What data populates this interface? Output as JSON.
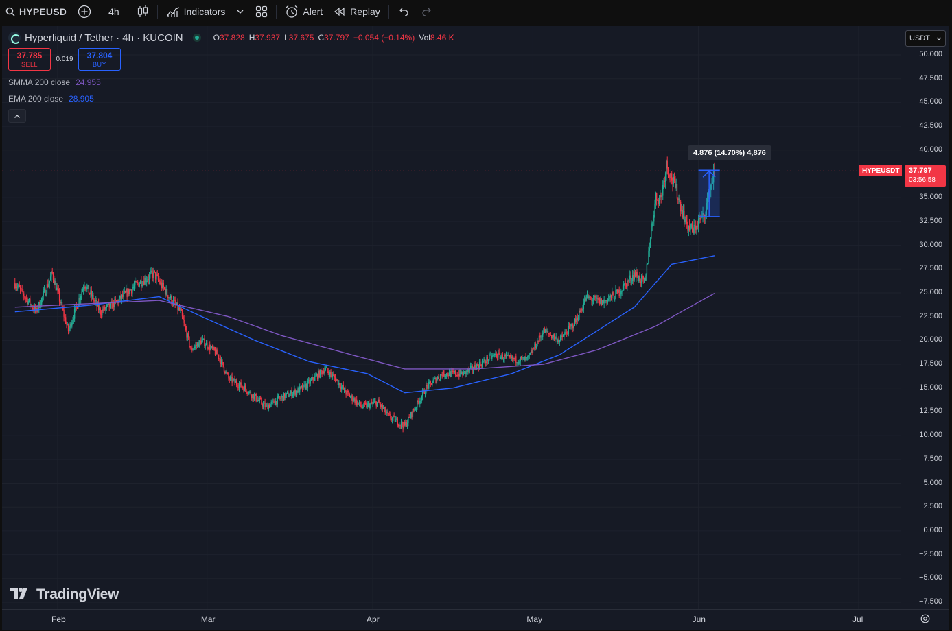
{
  "toolbar": {
    "symbol": "HYPEUSD",
    "interval": "4h",
    "indicators_label": "Indicators",
    "alert_label": "Alert",
    "replay_label": "Replay"
  },
  "legend": {
    "title": "Hyperliquid / Tether · 4h · KUCOIN",
    "ohlc": [
      {
        "k": "O",
        "v": "37.828"
      },
      {
        "k": "H",
        "v": "37.937"
      },
      {
        "k": "L",
        "v": "37.675"
      },
      {
        "k": "C",
        "v": "37.797"
      },
      {
        "k": "",
        "v": "−0.054 (−0.14%)"
      },
      {
        "k": "Vol",
        "v": "8.46 K"
      }
    ],
    "sell_price": "37.785",
    "sell_label": "SELL",
    "spread": "0.019",
    "buy_price": "37.804",
    "buy_label": "BUY",
    "indicators": [
      {
        "name": "SMMA",
        "params": "200 close",
        "value": "24.955",
        "color": "#7e57c2"
      },
      {
        "name": "EMA",
        "params": "200 close",
        "value": "28.905",
        "color": "#2962ff"
      }
    ]
  },
  "currency": "USDT",
  "price_scale": {
    "ticks": [
      "50.000",
      "47.500",
      "45.000",
      "42.500",
      "40.000",
      "35.000",
      "32.500",
      "30.000",
      "27.500",
      "25.000",
      "22.500",
      "20.000",
      "17.500",
      "15.000",
      "12.500",
      "10.000",
      "7.500",
      "5.000",
      "2.500",
      "0.000",
      "−2.500",
      "−5.000",
      "−7.500"
    ],
    "last_price": "37.797",
    "countdown": "03:56:58",
    "symbol_tag": "HYPEUSDT"
  },
  "time_scale": {
    "labels": [
      "Feb",
      "Mar",
      "Apr",
      "May",
      "Jun",
      "Jul"
    ]
  },
  "measure": {
    "label": "4.876 (14.70%) 4,876"
  },
  "watermark": "TradingView",
  "colors": {
    "up": "#22ab94",
    "down": "#f23645",
    "ema": "#2962ff",
    "smma": "#7e57c2",
    "background": "#161a25"
  },
  "chart_data": {
    "type": "candlestick",
    "ylim": [
      -7.5,
      50
    ],
    "x_months": [
      "Feb",
      "Mar",
      "Apr",
      "May",
      "Jun",
      "Jul"
    ],
    "price_path": [
      {
        "date": "2025-01-24",
        "price": 26
      },
      {
        "date": "2025-01-28",
        "price": 23
      },
      {
        "date": "2025-01-31",
        "price": 27
      },
      {
        "date": "2025-02-03",
        "price": 21
      },
      {
        "date": "2025-02-06",
        "price": 26
      },
      {
        "date": "2025-02-09",
        "price": 23
      },
      {
        "date": "2025-02-12",
        "price": 24
      },
      {
        "date": "2025-02-16",
        "price": 26
      },
      {
        "date": "2025-02-19",
        "price": 27
      },
      {
        "date": "2025-02-22",
        "price": 24.5
      },
      {
        "date": "2025-02-24",
        "price": 23
      },
      {
        "date": "2025-02-26",
        "price": 19
      },
      {
        "date": "2025-02-28",
        "price": 20
      },
      {
        "date": "2025-03-03",
        "price": 18.5
      },
      {
        "date": "2025-03-05",
        "price": 16
      },
      {
        "date": "2025-03-08",
        "price": 15
      },
      {
        "date": "2025-03-12",
        "price": 13
      },
      {
        "date": "2025-03-15",
        "price": 14
      },
      {
        "date": "2025-03-19",
        "price": 15
      },
      {
        "date": "2025-03-23",
        "price": 17
      },
      {
        "date": "2025-03-25",
        "price": 16
      },
      {
        "date": "2025-03-27",
        "price": 14.5
      },
      {
        "date": "2025-03-30",
        "price": 13
      },
      {
        "date": "2025-04-02",
        "price": 13.5
      },
      {
        "date": "2025-04-04",
        "price": 12
      },
      {
        "date": "2025-04-07",
        "price": 11
      },
      {
        "date": "2025-04-09",
        "price": 13
      },
      {
        "date": "2025-04-11",
        "price": 15
      },
      {
        "date": "2025-04-14",
        "price": 16.5
      },
      {
        "date": "2025-04-18",
        "price": 16.5
      },
      {
        "date": "2025-04-21",
        "price": 17.5
      },
      {
        "date": "2025-04-24",
        "price": 18.5
      },
      {
        "date": "2025-04-27",
        "price": 18
      },
      {
        "date": "2025-04-30",
        "price": 18
      },
      {
        "date": "2025-05-03",
        "price": 21
      },
      {
        "date": "2025-05-06",
        "price": 20
      },
      {
        "date": "2025-05-09",
        "price": 22
      },
      {
        "date": "2025-05-11",
        "price": 24.5
      },
      {
        "date": "2025-05-14",
        "price": 24
      },
      {
        "date": "2025-05-17",
        "price": 25
      },
      {
        "date": "2025-05-20",
        "price": 27
      },
      {
        "date": "2025-05-22",
        "price": 26
      },
      {
        "date": "2025-05-23",
        "price": 31
      },
      {
        "date": "2025-05-24",
        "price": 35
      },
      {
        "date": "2025-05-25",
        "price": 35
      },
      {
        "date": "2025-05-26",
        "price": 38.5
      },
      {
        "date": "2025-05-27",
        "price": 37
      },
      {
        "date": "2025-05-28",
        "price": 35.5
      },
      {
        "date": "2025-05-29",
        "price": 33.5
      },
      {
        "date": "2025-05-30",
        "price": 32
      },
      {
        "date": "2025-05-31",
        "price": 31.5
      },
      {
        "date": "2025-06-01",
        "price": 32.5
      },
      {
        "date": "2025-06-02",
        "price": 33
      },
      {
        "date": "2025-06-03",
        "price": 35.5
      },
      {
        "date": "2025-06-04",
        "price": 37.8
      }
    ],
    "series": [
      {
        "name": "EMA 200 close",
        "points": [
          {
            "date": "2025-01-24",
            "value": 23
          },
          {
            "date": "2025-02-07",
            "value": 23.7
          },
          {
            "date": "2025-02-20",
            "value": 24.6
          },
          {
            "date": "2025-02-28",
            "value": 22.5
          },
          {
            "date": "2025-03-10",
            "value": 20
          },
          {
            "date": "2025-03-20",
            "value": 17.8
          },
          {
            "date": "2025-03-31",
            "value": 16.5
          },
          {
            "date": "2025-04-07",
            "value": 14.5
          },
          {
            "date": "2025-04-16",
            "value": 15
          },
          {
            "date": "2025-04-27",
            "value": 16.5
          },
          {
            "date": "2025-05-06",
            "value": 18.5
          },
          {
            "date": "2025-05-13",
            "value": 21
          },
          {
            "date": "2025-05-20",
            "value": 23.5
          },
          {
            "date": "2025-05-27",
            "value": 28
          },
          {
            "date": "2025-06-04",
            "value": 28.9
          }
        ]
      },
      {
        "name": "SMMA 200 close",
        "points": [
          {
            "date": "2025-01-24",
            "value": 23.5
          },
          {
            "date": "2025-02-20",
            "value": 24.2
          },
          {
            "date": "2025-03-05",
            "value": 22.5
          },
          {
            "date": "2025-03-15",
            "value": 20.5
          },
          {
            "date": "2025-03-28",
            "value": 18.5
          },
          {
            "date": "2025-04-07",
            "value": 17
          },
          {
            "date": "2025-04-20",
            "value": 17
          },
          {
            "date": "2025-05-03",
            "value": 17.5
          },
          {
            "date": "2025-05-13",
            "value": 19
          },
          {
            "date": "2025-05-24",
            "value": 21.5
          },
          {
            "date": "2025-06-04",
            "value": 24.955
          }
        ]
      }
    ],
    "measure": {
      "from_date": "2025-06-01",
      "to_date": "2025-06-05",
      "low": 33.0,
      "high": 37.876
    },
    "last_price": 37.797
  }
}
